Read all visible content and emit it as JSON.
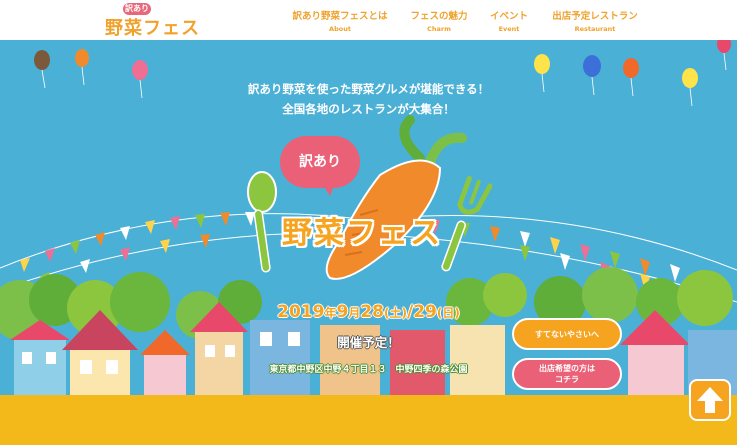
{
  "header": {
    "logo_badge": "訳あり",
    "logo_text": "野菜フェス",
    "nav": [
      {
        "jp": "訳あり野菜フェスとは",
        "en": "About"
      },
      {
        "jp": "フェスの魅力",
        "en": "Charm"
      },
      {
        "jp": "イベント",
        "en": "Event"
      },
      {
        "jp": "出店予定レストラン",
        "en": "Restaurant"
      }
    ]
  },
  "hero": {
    "lead1": "訳あり野菜を使った野菜グルメが堪能できる！",
    "lead2": "全国各地のレストランが大集合！",
    "bubble": "訳あり",
    "title": "野菜フェス",
    "date": {
      "year": "2019",
      "y_suffix": "年",
      "month": "9",
      "m_suffix": "月",
      "day1": "28",
      "dow1": "(土)",
      "slash": "/",
      "day2": "29",
      "dow2": "(日)"
    },
    "plan": "開催予定！",
    "address": "東京都中野区中野４丁目１３　中野四季の森公園",
    "cta1": "すてないやさいへ",
    "cta2_line1": "出店希望の方は",
    "cta2_line2": "コチラ"
  },
  "colors": {
    "accent_orange": "#f6a31f",
    "accent_pink": "#ea6077",
    "sky": "#4bb0d6",
    "grass": "#8cc63f"
  },
  "icons": {
    "to_top": "arrow-up-icon"
  }
}
